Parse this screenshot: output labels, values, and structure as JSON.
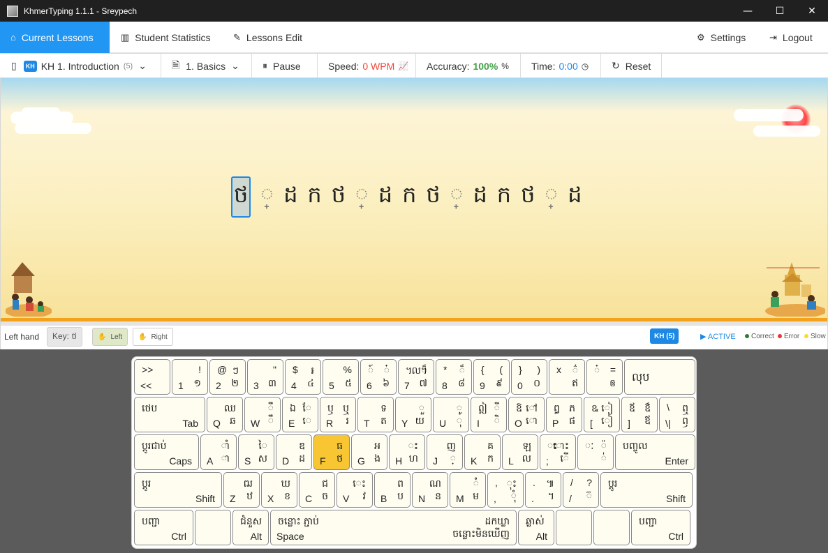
{
  "window": {
    "title": "KhmerTyping 1.1.1 - Sreypech",
    "minimize": "—",
    "maximize": "☐",
    "close": "✕"
  },
  "nav": {
    "current_lessons": "Current Lessons",
    "student_statistics": "Student Statistics",
    "lessons_edit": "Lessons Edit",
    "settings": "Settings",
    "logout": "Logout"
  },
  "toolbar": {
    "lang_badge": "KH",
    "lesson": "KH 1. Introduction",
    "lesson_count": "(5)",
    "section": "1. Basics",
    "pause": "Pause",
    "speed_label": "Speed:",
    "speed_value": "0 WPM",
    "accuracy_label": "Accuracy:",
    "accuracy_value": "100%",
    "accuracy_unit": "%",
    "time_label": "Time:",
    "time_value": "0:00",
    "reset": "Reset"
  },
  "prompt_chars": [
    "ថ",
    "្",
    "ដ",
    "ក",
    "ថ",
    "្",
    "ដ",
    "ក",
    "ថ",
    "្",
    "ដ",
    "ក",
    "ថ",
    "្",
    "ដ"
  ],
  "status": {
    "hand_label": "Left hand",
    "key_label": "Key: ថ",
    "left": "Left",
    "right": "Right",
    "kh_badge": "KH (5)",
    "active": "ACTIVE",
    "correct": "Correct",
    "error": "Error",
    "slow": "Slow"
  },
  "colors": {
    "accent": "#2196f3",
    "correct": "#2e7d32",
    "error": "#e53935",
    "slow": "#fdd835",
    "highlight_key": "#f7c632"
  },
  "keyboard": {
    "rows": [
      [
        {
          "tl": ">>",
          "bl": "<<"
        },
        {
          "tr": "!",
          "bl": "1",
          "br": "១"
        },
        {
          "tl": "@",
          "tr": "ៗ",
          "bl": "2",
          "br": "២"
        },
        {
          "tr": "\"",
          "bl": "3",
          "br": "៣"
        },
        {
          "tl": "$",
          "tr": "៛",
          "bl": "4",
          "br": "៤"
        },
        {
          "tr": "%",
          "bl": "5",
          "br": "៥"
        },
        {
          "tl": "៍",
          "tr": "៎",
          "bl": "6",
          "br": "៦"
        },
        {
          "tl": "៘",
          "tr": "៏",
          "bl": "7",
          "br": "៧"
        },
        {
          "tl": "*",
          "tr": "៏",
          "bl": "8",
          "br": "៨"
        },
        {
          "tl": "{",
          "tr": "(",
          "bl": "9",
          "br": "៩"
        },
        {
          "tl": "}",
          "tr": ")",
          "bl": "0",
          "br": "០"
        },
        {
          "tl": "x",
          "tr": "៌",
          "br": "ឥ"
        },
        {
          "tl": "៎",
          "tr": "=",
          "br": "ឲ"
        },
        {
          "mid": "លុប"
        }
      ],
      [
        {
          "tl": "ថេប",
          "br": "Tab"
        },
        {
          "tr": "ឈ",
          "bl": "Q",
          "br": "ឆ"
        },
        {
          "tr": "ឺ",
          "bl": "W",
          "br": "ឹ"
        },
        {
          "tl": "ឯ",
          "tr": "ែ",
          "bl": "E",
          "br": "េ"
        },
        {
          "tl": "ឫ",
          "tr": "ឬ",
          "bl": "R",
          "br": "រ"
        },
        {
          "tr": "ទ",
          "bl": "T",
          "br": "ត"
        },
        {
          "tr": "ួ",
          "bl": "Y",
          "br": "យ"
        },
        {
          "tr": "ូ",
          "bl": "U",
          "br": "ុ"
        },
        {
          "tl": "ឦ",
          "tr": "ី",
          "bl": "I",
          "br": "ិ"
        },
        {
          "tl": "ឱ",
          "tr": "ៅ",
          "bl": "O",
          "br": "ោ"
        },
        {
          "tl": "ឰ",
          "tr": "ភ",
          "bl": "P",
          "br": "ផ"
        },
        {
          "tl": "ឩ",
          "tr": "ៀ",
          "bl": "[",
          "br": "ៀ"
        },
        {
          "tl": "ឪ",
          "tr": "ឳ",
          "bl": "]",
          "br": "ឪ"
        },
        {
          "tl": "\\",
          "tr": "ឮ",
          "bl": "\\|",
          "br": "ឭ"
        }
      ],
      [
        {
          "tl": "ប្តូរជាប់",
          "br": "Caps"
        },
        {
          "tr": "ាំ",
          "bl": "A",
          "br": "ា"
        },
        {
          "tr": "ៃ",
          "bl": "S",
          "br": "ស"
        },
        {
          "tr": "ឌ",
          "bl": "D",
          "br": "ដ"
        },
        {
          "tr": "ធ",
          "bl": "F",
          "br": "ថ"
        },
        {
          "tr": "អ",
          "bl": "G",
          "br": "ង"
        },
        {
          "tr": "ះ",
          "bl": "H",
          "br": "ហ"
        },
        {
          "tr": "ញ",
          "bl": "J",
          "br": "្"
        },
        {
          "tr": "គ",
          "bl": "K",
          "br": "ក"
        },
        {
          "tr": "ឡ",
          "bl": "L",
          "br": "ល"
        },
        {
          "tl": "ះ",
          "tr": "ោះ",
          "bl": ";",
          "br": "ើ"
        },
        {
          "tl": "ៈ",
          "tr": "៉",
          "br": "់"
        },
        {
          "tl": "បញ្ចូល",
          "br": "Enter"
        }
      ],
      [
        {
          "tl": "ប្តូរ",
          "br": "Shift"
        },
        {
          "tr": "ឍ",
          "bl": "Z",
          "br": "ឋ"
        },
        {
          "tr": "ឃ",
          "bl": "X",
          "br": "ខ"
        },
        {
          "tr": "ជ",
          "bl": "C",
          "br": "ច"
        },
        {
          "tr": "េះ",
          "bl": "V",
          "br": "វ"
        },
        {
          "tr": "ព",
          "bl": "B",
          "br": "ប"
        },
        {
          "tr": "ណ",
          "bl": "N",
          "br": "ន"
        },
        {
          "tr": "ំ",
          "bl": "M",
          "br": "ម"
        },
        {
          "tl": ",",
          "tr": "ុះ",
          "bl": ",",
          "br": "ុំ"
        },
        {
          "tl": ".",
          "tr": "៕",
          "bl": ".",
          "br": "។"
        },
        {
          "tl": "/",
          "tr": "?",
          "bl": "/",
          "br": "៊"
        },
        {
          "tl": "ប្តូរ",
          "br": "Shift"
        }
      ],
      [
        {
          "tl": "បញ្ជា",
          "br": "Ctrl"
        },
        {},
        {
          "tl": "ជំនួស",
          "br": "Alt"
        },
        {
          "tl": "ចន្លោះ ភ្ជាប់",
          "tr": "ដកឃ្លា",
          "bl": "Space",
          "br": "ចន្លោះមិនឃើញ"
        },
        {
          "tl": "ឆ្លាស់",
          "br": "Alt"
        },
        {},
        {},
        {
          "tl": "បញ្ជា",
          "br": "Ctrl"
        }
      ]
    ]
  }
}
